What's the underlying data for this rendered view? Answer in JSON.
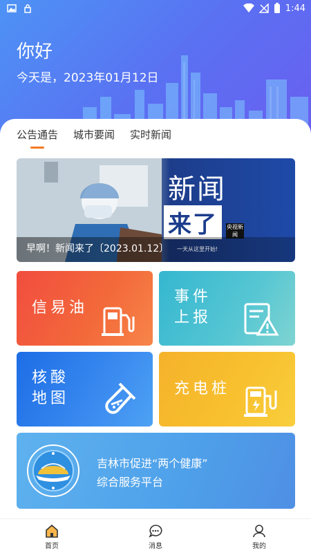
{
  "statusbar": {
    "time": "1:44"
  },
  "header": {
    "greeting": "你好",
    "date": "今天是，2023年01月12日"
  },
  "tabs": [
    {
      "label": "公告通告",
      "active": true
    },
    {
      "label": "城市要闻",
      "active": false
    },
    {
      "label": "实时新闻",
      "active": false
    }
  ],
  "banner": {
    "title": "新闻",
    "subtitle": "来了",
    "cctv_badge": "央视新闻",
    "caption": "早啊！新闻来了〔2023.01.12〕",
    "caption_note": "一天从这里开始!"
  },
  "tiles": {
    "oil": {
      "label": "信易油",
      "icon": "fuel-pump-icon",
      "color": "#f14d3f"
    },
    "report_line1": "事件",
    "report_line2": "上报",
    "report_icon": "report-warning-icon",
    "test_line1": "核酸",
    "test_line2": "地图",
    "test_icon": "test-tube-icon",
    "charge": {
      "label": "充电桩",
      "icon": "charging-station-icon",
      "color": "#f5b22b"
    }
  },
  "platform": {
    "line1": "吉林市促进“两个健康”",
    "line2": "综合服务平台",
    "logo": "platform-logo"
  },
  "bottom_nav": [
    {
      "label": "首页",
      "icon": "home-icon",
      "active": true
    },
    {
      "label": "消息",
      "icon": "message-icon",
      "active": false
    },
    {
      "label": "我的",
      "icon": "profile-icon",
      "active": false
    }
  ],
  "colors": {
    "accent": "#f47a22",
    "hero_start": "#4d93f5",
    "hero_end": "#6a5ff0"
  }
}
